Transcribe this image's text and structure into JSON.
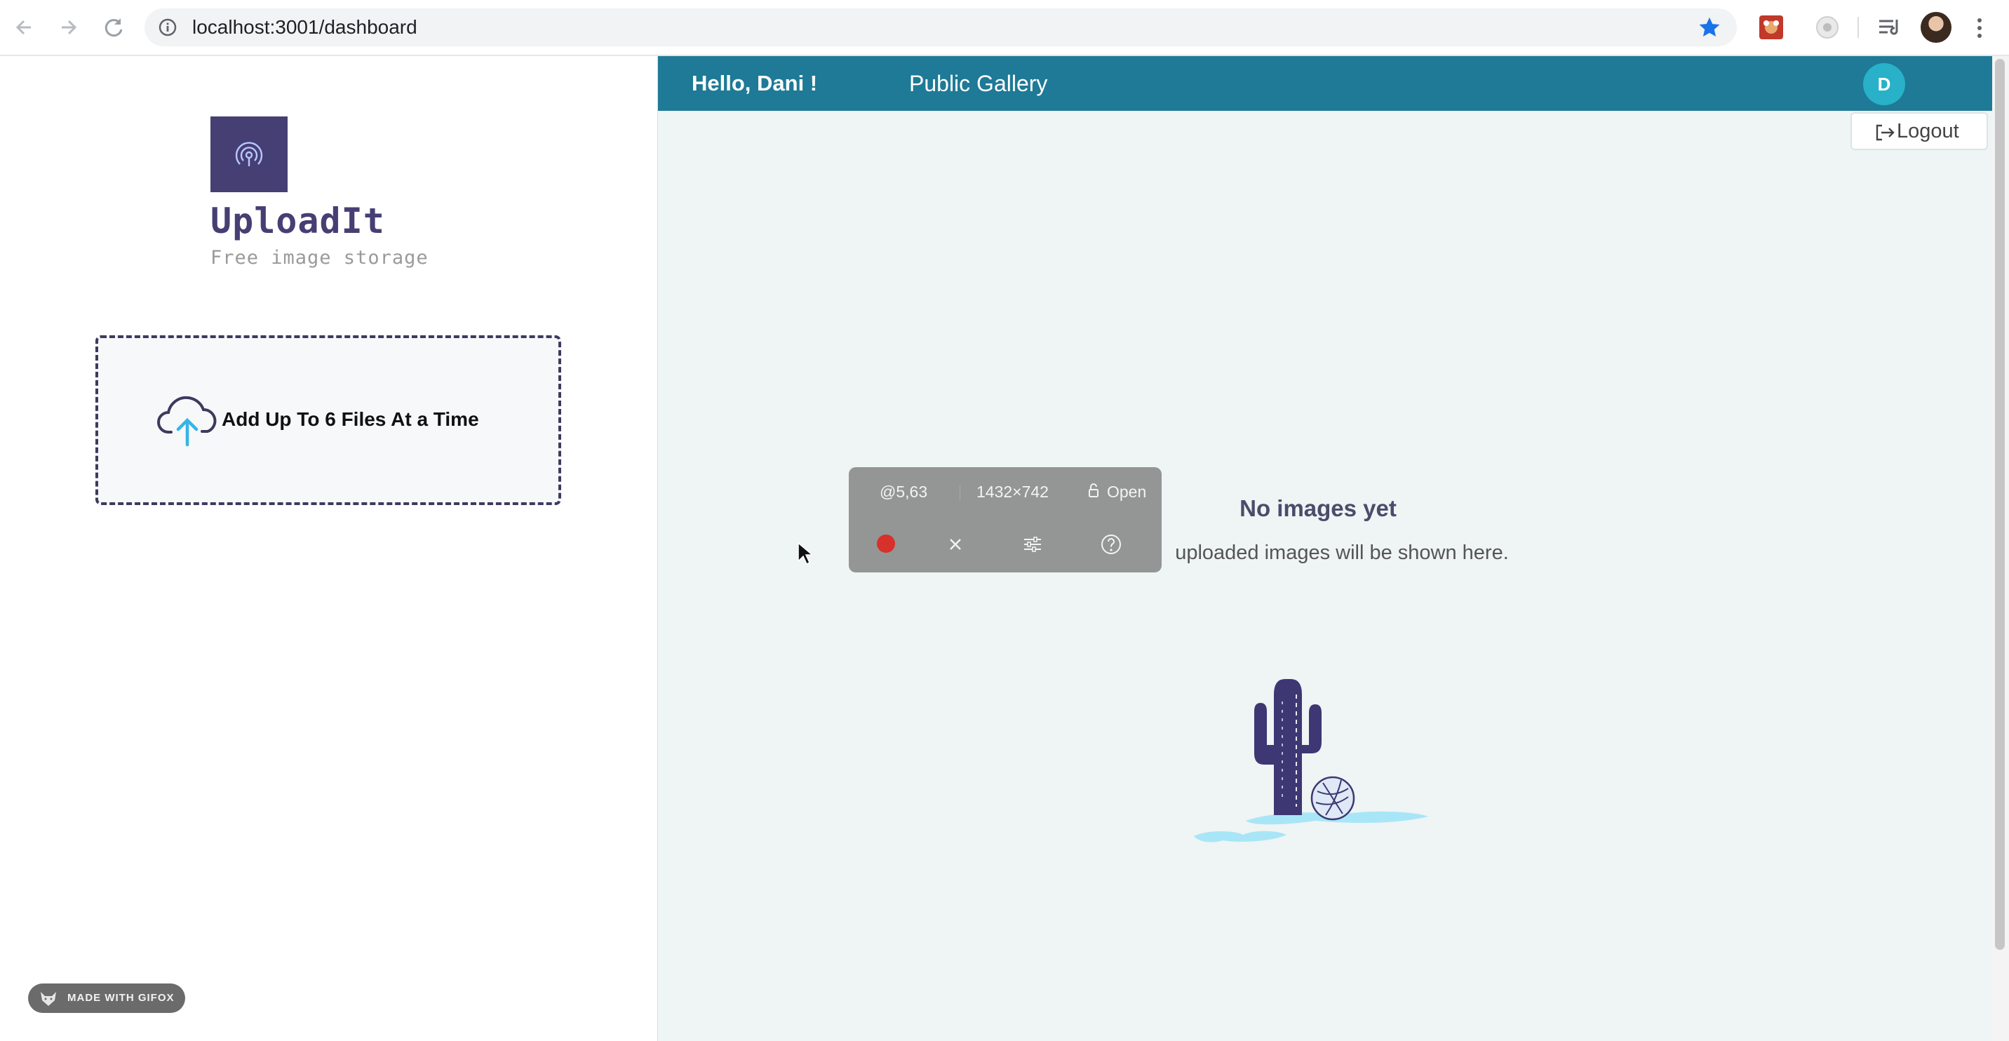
{
  "browser": {
    "url": "localhost:3001/dashboard",
    "icons": [
      "back-arrow-icon",
      "forward-arrow-icon",
      "reload-icon",
      "info-icon",
      "star-icon",
      "extension-icon",
      "media-icon",
      "menu-icon"
    ]
  },
  "sidebar": {
    "brand_name": "UploadIt",
    "tagline": "Free image storage",
    "dropzone_label": "Add Up To 6 Files At a Time",
    "badge_label": "MADE WITH GIFOX"
  },
  "header": {
    "greeting": "Hello, Dani !",
    "gallery_link": "Public Gallery",
    "avatar_initial": "D",
    "logout_label": "Logout"
  },
  "main": {
    "empty_title": "No images yet",
    "empty_subtitle": "uploaded images will be shown here."
  },
  "recorder": {
    "position_text": "@5,63",
    "size_text": "1432×742",
    "open_label": "Open"
  },
  "colors": {
    "brand": "#463f74",
    "header": "#1e7a96",
    "avatar": "#28b1c9",
    "record": "#d6312a"
  }
}
